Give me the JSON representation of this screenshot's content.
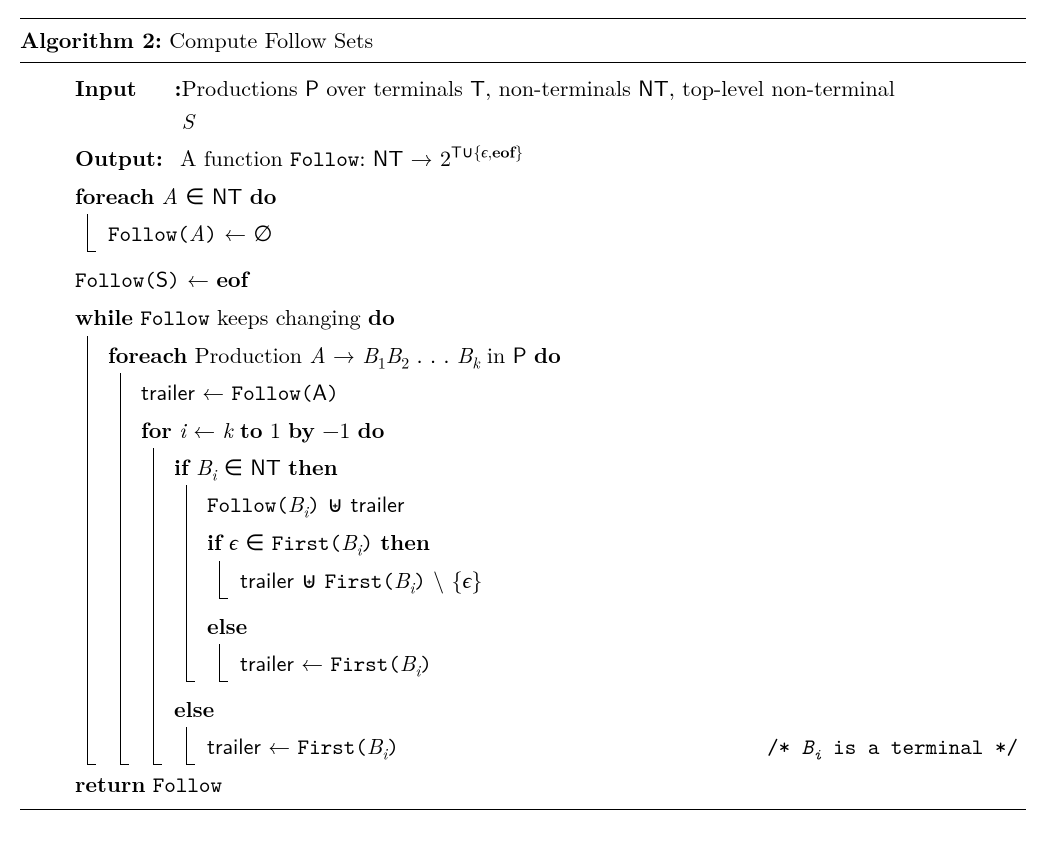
{
  "title": {
    "label": "Algorithm 2:",
    "name": "Compute Follow Sets"
  },
  "io": {
    "input_label": "Input",
    "input_text_1": "Productions ",
    "input_P": "P",
    "input_text_2": " over terminals ",
    "input_T": "T",
    "input_text_3": ", non-terminals ",
    "input_NT": "NT",
    "input_text_4": ", top-level non-terminal ",
    "input_S": "S",
    "output_label": "Output",
    "output_text_1": "A function ",
    "output_follow": "Follow",
    "output_colon": ": ",
    "output_NT": "NT",
    "output_arrow": " → 2",
    "output_exp_T": "T",
    "output_exp_cup": "∪{",
    "output_exp_eps": "ϵ",
    "output_exp_comma": ",",
    "output_exp_eof": "eof",
    "output_exp_close": "}"
  },
  "kw": {
    "foreach": "foreach",
    "do": "do",
    "while": "while",
    "for": "for",
    "to": "to",
    "by": "by",
    "if": "if",
    "then": "then",
    "else": "else",
    "return": "return",
    "eof": "eof"
  },
  "lines": {
    "l1_A": "A",
    "l1_in": " ∈ ",
    "l1_NT": "NT",
    "l2_follow": "Follow(",
    "l2_A": "A",
    "l2_close": ")",
    "l2_assign": " ← ∅",
    "l3_follow": "Follow(",
    "l3_S": "S",
    "l3_close": ")",
    "l3_assign": " ← ",
    "l4_follow": "Follow",
    "l4_text": " keeps changing ",
    "l5_text1": "Production ",
    "l5_A": "A",
    "l5_arrow": " → ",
    "l5_B1": "B",
    "l5_sub1": "1",
    "l5_B2": "B",
    "l5_sub2": "2",
    "l5_dots": " . . . ",
    "l5_Bk": "B",
    "l5_subk": "k",
    "l5_in": " in ",
    "l5_P": "P",
    "l6_trailer": "trailer",
    "l6_assign": " ← ",
    "l6_follow": "Follow(",
    "l6_A": "A",
    "l6_close": ")",
    "l7_i": "i",
    "l7_assign": " ← ",
    "l7_k": "k",
    "l7_one": " 1 ",
    "l7_neg1": " −1 ",
    "l8_Bi": "B",
    "l8_subi": "i",
    "l8_in": " ∈ ",
    "l8_NT": "NT",
    "l9_follow": "Follow(",
    "l9_Bi": "B",
    "l9_subi": "i",
    "l9_close": ")",
    "l9_uplus": " ⊎ ",
    "l9_trailer": "trailer",
    "l10_eps": "ϵ",
    "l10_in": " ∈ ",
    "l10_first": "First(",
    "l10_Bi": "B",
    "l10_subi": "i",
    "l10_close": ")",
    "l11_trailer": "trailer",
    "l11_uplus": " ⊎ ",
    "l11_first": "First(",
    "l11_Bi": "B",
    "l11_subi": "i",
    "l11_close": ")",
    "l11_setminus": " \\ {",
    "l11_eps": "ϵ",
    "l11_brace": "}",
    "l12_trailer": "trailer",
    "l12_assign": " ← ",
    "l12_first": "First(",
    "l12_Bi": "B",
    "l12_subi": "i",
    "l12_close": ")",
    "l13_trailer": "trailer",
    "l13_assign": " ← ",
    "l13_first": "First(",
    "l13_Bi": "B",
    "l13_subi": "i",
    "l13_close": ")",
    "l13_comment_open": "/* ",
    "l13_comment_Bi": "B",
    "l13_comment_subi": "i",
    "l13_comment_text": " is a terminal ",
    "l13_comment_close": "*/",
    "l14_follow": "Follow"
  }
}
